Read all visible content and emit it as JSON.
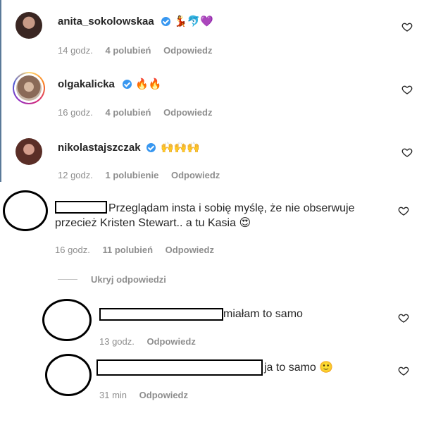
{
  "comments": [
    {
      "username": "anita_sokolowskaa",
      "emojis": "💃🐬💜",
      "time": "14 godz.",
      "likes": "4 polubień",
      "reply": "Odpowiedz"
    },
    {
      "username": "olgakalicka",
      "emojis": "🔥🔥",
      "time": "16 godz.",
      "likes": "4 polubień",
      "reply": "Odpowiedz"
    },
    {
      "username": "nikolastajszczak",
      "emojis": "🙌🙌🙌",
      "time": "12 godz.",
      "likes": "1 polubienie",
      "reply": "Odpowiedz"
    },
    {
      "text_line1": "Przeglądam insta i sobię myślę, że nie obserwuje",
      "text_line2": "przecież Kristen Stewart.. a tu Kasia",
      "emoji": "😍",
      "time": "16 godz.",
      "likes": "11 polubień",
      "reply": "Odpowiedz"
    }
  ],
  "replies_toggle": "Ukryj odpowiedzi",
  "replies": [
    {
      "text": "miałam to samo",
      "time": "13 godz.",
      "reply": "Odpowiedz"
    },
    {
      "text": "ja to samo",
      "emoji": "🙂",
      "time": "31 min",
      "reply": "Odpowiedz"
    }
  ],
  "icons": [
    "verified-badge-icon",
    "heart-icon"
  ],
  "colors": {
    "verified": "#3897f0",
    "meta_text": "#8e8e8e",
    "text": "#262626"
  }
}
